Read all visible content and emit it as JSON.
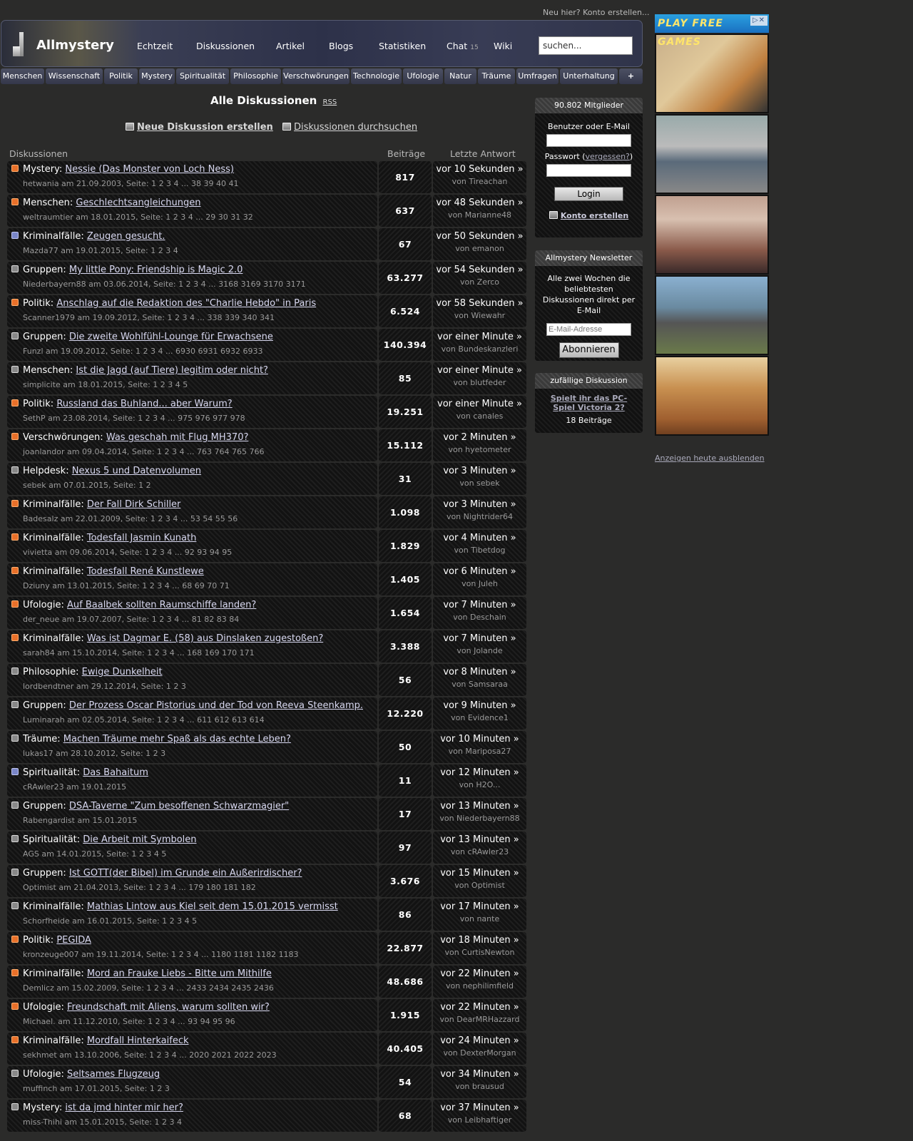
{
  "top_link": "Neu hier? Konto erstellen...",
  "site_name": "Allmystery",
  "nav": [
    "Echtzeit",
    "Diskussionen",
    "Artikel",
    "Blogs",
    "Statistiken",
    "Chat",
    "Wiki"
  ],
  "chat_count": "15",
  "search_placeholder": "suchen...",
  "categories": [
    "Menschen",
    "Wissenschaft",
    "Politik",
    "Mystery",
    "Spiritualität",
    "Philosophie",
    "Verschwörungen",
    "Technologie",
    "Ufologie",
    "Natur",
    "Träume",
    "Umfragen",
    "Unterhaltung",
    "+"
  ],
  "page_title": "Alle Diskussionen",
  "rss_label": "RSS",
  "new_discussion": "Neue Diskussion erstellen",
  "search_discussions": "Diskussionen durchsuchen",
  "columns": {
    "topic": "Diskussionen",
    "posts": "Beiträge",
    "last": "Letzte Antwort"
  },
  "threads": [
    {
      "cat": "Mystery",
      "title": "Nessie (Das Monster von Loch Ness)",
      "meta": "hetwania am 21.09.2003, Seite: 1 2 3 4 ... 38 39 40 41",
      "posts": "817",
      "time": "vor 10 Sekunden »",
      "by": "von Tireachan",
      "icon": "orange"
    },
    {
      "cat": "Menschen",
      "title": "Geschlechtsangleichungen",
      "meta": "weltraumtier am 18.01.2015, Seite: 1 2 3 4 ... 29 30 31 32",
      "posts": "637",
      "time": "vor 48 Sekunden »",
      "by": "von Marianne48",
      "icon": "orange"
    },
    {
      "cat": "Kriminalfälle",
      "title": "Zeugen gesucht.",
      "meta": "Mazda77 am 19.01.2015, Seite: 1 2 3 4",
      "posts": "67",
      "time": "vor 50 Sekunden »",
      "by": "von emanon",
      "icon": "blue"
    },
    {
      "cat": "Gruppen",
      "title": "My little Pony: Friendship is Magic 2.0",
      "meta": "Niederbayern88 am 03.06.2014, Seite: 1 2 3 4 ... 3168 3169 3170 3171",
      "posts": "63.277",
      "time": "vor 54 Sekunden »",
      "by": "von Zerco",
      "icon": "gray"
    },
    {
      "cat": "Politik",
      "title": "Anschlag auf die Redaktion des \"Charlie Hebdo\" in Paris",
      "meta": "Scanner1979 am 19.09.2012, Seite: 1 2 3 4 ... 338 339 340 341",
      "posts": "6.524",
      "time": "vor 58 Sekunden »",
      "by": "von Wiewahr",
      "icon": "orange"
    },
    {
      "cat": "Gruppen",
      "title": "Die zweite Wohlfühl-Lounge für Erwachsene",
      "meta": "Funzl am 19.09.2012, Seite: 1 2 3 4 ... 6930 6931 6932 6933",
      "posts": "140.394",
      "time": "vor einer Minute »",
      "by": "von Bundeskanzleri",
      "icon": "gray"
    },
    {
      "cat": "Menschen",
      "title": "Ist die Jagd (auf Tiere) legitim oder nicht?",
      "meta": "simplicite am 18.01.2015, Seite: 1 2 3 4 5",
      "posts": "85",
      "time": "vor einer Minute »",
      "by": "von blutfeder",
      "icon": "gray"
    },
    {
      "cat": "Politik",
      "title": "Russland das Buhland... aber Warum?",
      "meta": "SethP am 23.08.2014, Seite: 1 2 3 4 ... 975 976 977 978",
      "posts": "19.251",
      "time": "vor einer Minute »",
      "by": "von canales",
      "icon": "orange"
    },
    {
      "cat": "Verschwörungen",
      "title": "Was geschah mit Flug MH370?",
      "meta": "joanlandor am 09.04.2014, Seite: 1 2 3 4 ... 763 764 765 766",
      "posts": "15.112",
      "time": "vor 2 Minuten »",
      "by": "von hyetometer",
      "icon": "orange"
    },
    {
      "cat": "Helpdesk",
      "title": "Nexus 5 und Datenvolumen",
      "meta": "sebek am 07.01.2015, Seite: 1 2",
      "posts": "31",
      "time": "vor 3 Minuten »",
      "by": "von sebek",
      "icon": "gray"
    },
    {
      "cat": "Kriminalfälle",
      "title": "Der Fall Dirk Schiller",
      "meta": "Badesalz am 22.01.2009, Seite: 1 2 3 4 ... 53 54 55 56",
      "posts": "1.098",
      "time": "vor 3 Minuten »",
      "by": "von Nightrider64",
      "icon": "orange"
    },
    {
      "cat": "Kriminalfälle",
      "title": "Todesfall Jasmin Kunath",
      "meta": "vivietta am 09.06.2014, Seite: 1 2 3 4 ... 92 93 94 95",
      "posts": "1.829",
      "time": "vor 4 Minuten »",
      "by": "von Tibetdog",
      "icon": "orange"
    },
    {
      "cat": "Kriminalfälle",
      "title": "Todesfall René Kunstlewe",
      "meta": "Dziuny am 13.01.2015, Seite: 1 2 3 4 ... 68 69 70 71",
      "posts": "1.405",
      "time": "vor 6 Minuten »",
      "by": "von Juleh",
      "icon": "orange"
    },
    {
      "cat": "Ufologie",
      "title": "Auf Baalbek sollten Raumschiffe landen?",
      "meta": "der_neue am 19.07.2007, Seite: 1 2 3 4 ... 81 82 83 84",
      "posts": "1.654",
      "time": "vor 7 Minuten »",
      "by": "von Deschain",
      "icon": "orange"
    },
    {
      "cat": "Kriminalfälle",
      "title": "Was ist Dagmar E. (58) aus Dinslaken zugestoßen?",
      "meta": "sarah84 am 15.10.2014, Seite: 1 2 3 4 ... 168 169 170 171",
      "posts": "3.388",
      "time": "vor 7 Minuten »",
      "by": "von Jolande",
      "icon": "orange"
    },
    {
      "cat": "Philosophie",
      "title": "Ewige Dunkelheit",
      "meta": "lordbendtner am 29.12.2014, Seite: 1 2 3",
      "posts": "56",
      "time": "vor 8 Minuten »",
      "by": "von Samsaraa",
      "icon": "gray"
    },
    {
      "cat": "Gruppen",
      "title": "Der Prozess Oscar Pistorius und der Tod von Reeva Steenkamp.",
      "meta": "Luminarah am 02.05.2014, Seite: 1 2 3 4 ... 611 612 613 614",
      "posts": "12.220",
      "time": "vor 9 Minuten »",
      "by": "von Evidence1",
      "icon": "gray"
    },
    {
      "cat": "Träume",
      "title": "Machen Träume mehr Spaß als das echte Leben?",
      "meta": "lukas17 am 28.10.2012, Seite: 1 2 3",
      "posts": "50",
      "time": "vor 10 Minuten »",
      "by": "von Mariposa27",
      "icon": "gray"
    },
    {
      "cat": "Spiritualität",
      "title": "Das Bahaitum",
      "meta": "cRAwler23 am 19.01.2015",
      "posts": "11",
      "time": "vor 12 Minuten »",
      "by": "von H2O...",
      "icon": "blue"
    },
    {
      "cat": "Gruppen",
      "title": "DSA-Taverne \"Zum besoffenen Schwarzmagier\"",
      "meta": "Rabengardist am 15.01.2015",
      "posts": "17",
      "time": "vor 13 Minuten »",
      "by": "von Niederbayern88",
      "icon": "gray"
    },
    {
      "cat": "Spiritualität",
      "title": "Die Arbeit mit Symbolen",
      "meta": "AGS am 14.01.2015, Seite: 1 2 3 4 5",
      "posts": "97",
      "time": "vor 13 Minuten »",
      "by": "von cRAwler23",
      "icon": "gray"
    },
    {
      "cat": "Gruppen",
      "title": "Ist GOTT(der Bibel) im Grunde ein Außerirdischer?",
      "meta": "Optimist am 21.04.2013, Seite: 1 2 3 4 ... 179 180 181 182",
      "posts": "3.676",
      "time": "vor 15 Minuten »",
      "by": "von Optimist",
      "icon": "gray"
    },
    {
      "cat": "Kriminalfälle",
      "title": "Mathias Lintow aus Kiel seit dem 15.01.2015 vermisst",
      "meta": "Schorfheide am 16.01.2015, Seite: 1 2 3 4 5",
      "posts": "86",
      "time": "vor 17 Minuten »",
      "by": "von nante",
      "icon": "gray"
    },
    {
      "cat": "Politik",
      "title": "PEGIDA",
      "meta": "kronzeuge007 am 19.11.2014, Seite: 1 2 3 4 ... 1180 1181 1182 1183",
      "posts": "22.877",
      "time": "vor 18 Minuten »",
      "by": "von CurtisNewton",
      "icon": "orange"
    },
    {
      "cat": "Kriminalfälle",
      "title": "Mord an Frauke Liebs - Bitte um Mithilfe",
      "meta": "Demlicz am 15.02.2009, Seite: 1 2 3 4 ... 2433 2434 2435 2436",
      "posts": "48.686",
      "time": "vor 22 Minuten »",
      "by": "von nephilimfield",
      "icon": "orange"
    },
    {
      "cat": "Ufologie",
      "title": "Freundschaft mit Aliens, warum sollten wir?",
      "meta": "Michael. am 11.12.2010, Seite: 1 2 3 4 ... 93 94 95 96",
      "posts": "1.915",
      "time": "vor 22 Minuten »",
      "by": "von DearMRHazzard",
      "icon": "orange"
    },
    {
      "cat": "Kriminalfälle",
      "title": "Mordfall Hinterkaifeck",
      "meta": "sekhmet am 13.10.2006, Seite: 1 2 3 4 ... 2020 2021 2022 2023",
      "posts": "40.405",
      "time": "vor 24 Minuten »",
      "by": "von DexterMorgan",
      "icon": "orange"
    },
    {
      "cat": "Ufologie",
      "title": "Seltsames Flugzeug",
      "meta": "muffinch am 17.01.2015, Seite: 1 2 3",
      "posts": "54",
      "time": "vor 34 Minuten »",
      "by": "von brausud",
      "icon": "gray"
    },
    {
      "cat": "Mystery",
      "title": "ist da jmd hinter mir her?",
      "meta": "miss-Thihi am 15.01.2015, Seite: 1 2 3 4",
      "posts": "68",
      "time": "vor 37 Minuten »",
      "by": "von Leibhaftiger",
      "icon": "gray"
    }
  ],
  "sidebar": {
    "members": "90.802 Mitglieder",
    "user_label": "Benutzer oder E-Mail",
    "pw_label": "Passwort (",
    "pw_forgot": "vergessen?",
    "pw_close": ")",
    "login": "Login",
    "create_account": "Konto erstellen",
    "newsletter_head": "Allmystery Newsletter",
    "newsletter_text": "Alle zwei Wochen die beliebtesten Diskussionen direkt per E-Mail",
    "email_placeholder": "E-Mail-Adresse",
    "subscribe": "Abonnieren",
    "random_head": "zufällige Diskussion",
    "random_title": "Spielt ihr das PC-Spiel Victoria 2?",
    "random_posts": "18 Beiträge"
  },
  "ads": {
    "banner": "PLAY FREE GAMES",
    "banner_close": "▷✕",
    "hide": "Anzeigen heute ausblenden"
  }
}
